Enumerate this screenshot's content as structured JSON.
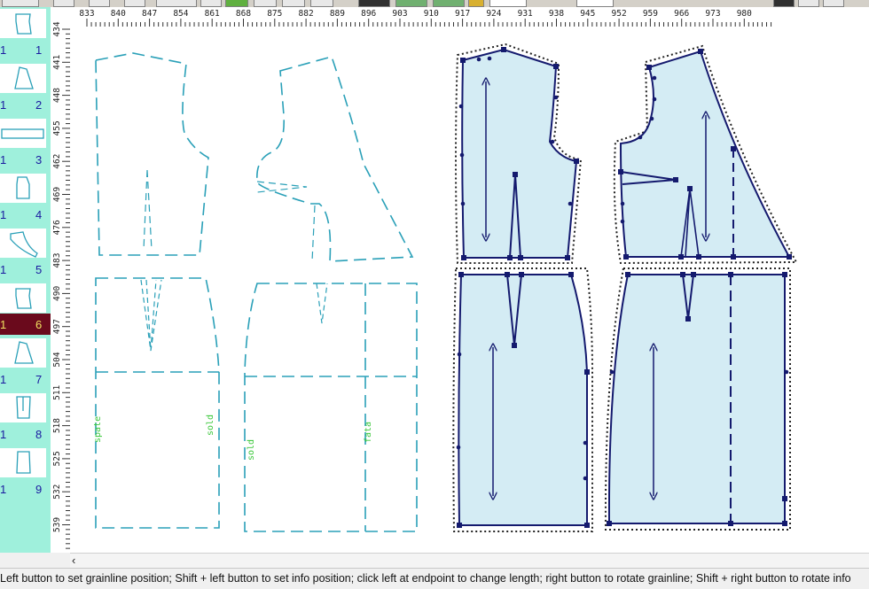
{
  "ruler": {
    "h_ticks": [
      "833",
      "840",
      "847",
      "854",
      "861",
      "868",
      "875",
      "882",
      "889",
      "896",
      "903",
      "910",
      "917",
      "924",
      "931",
      "938",
      "945",
      "952",
      "959",
      "966",
      "973",
      "980"
    ],
    "v_ticks": [
      "434",
      "441",
      "448",
      "455",
      "462",
      "469",
      "476",
      "483",
      "490",
      "497",
      "504",
      "511",
      "518",
      "525",
      "532",
      "539"
    ]
  },
  "piece_list": {
    "items": [
      {
        "number": "1",
        "index": "1"
      },
      {
        "number": "1",
        "index": "2"
      },
      {
        "number": "1",
        "index": "3"
      },
      {
        "number": "1",
        "index": "4"
      },
      {
        "number": "1",
        "index": "5",
        "selected": true
      },
      {
        "number": "1",
        "index": "6"
      },
      {
        "number": "1",
        "index": "7"
      },
      {
        "number": "1",
        "index": "8"
      },
      {
        "number": "1",
        "index": "9"
      }
    ]
  },
  "canvas": {
    "labels": {
      "spate": "spate",
      "solid_a": "sold",
      "solid_b": "sold",
      "fata": "fata"
    },
    "colors": {
      "outline_pieces": "#2aa0b8",
      "fill_pieces": "#d4ecf4",
      "stroke_pieces": "#141a6e",
      "label_green": "#3cc83c"
    }
  },
  "status": {
    "message": "Left button to set grainline position; Shift + left button to set info position; click left at endpoint to change length; right button to rotate grainline; Shift + right button to rotate info"
  }
}
